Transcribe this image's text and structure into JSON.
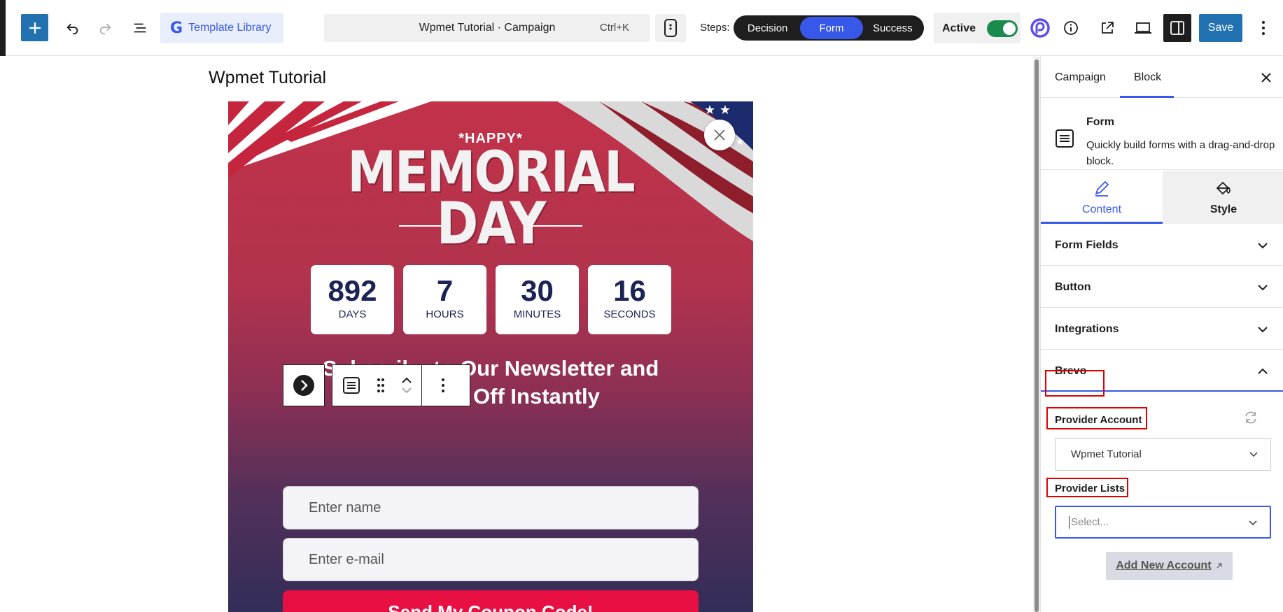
{
  "toolbar": {
    "template_library": "Template Library",
    "command_title": "Wpmet Tutorial · Campaign",
    "command_shortcut": "Ctrl+K",
    "steps_label": "Steps:",
    "steps": [
      "Decision",
      "Form",
      "Success"
    ],
    "active_step": "Form",
    "active_label": "Active",
    "active_on": true,
    "save_label": "Save",
    "accent_color": "#2271b1",
    "toggle_color": "#1a8a4d"
  },
  "canvas": {
    "page_title": "Wpmet Tutorial",
    "popup": {
      "happy": "*HAPPY*",
      "memorial": "MEMORIAL",
      "day": "DAY",
      "countdown": [
        {
          "value": "892",
          "unit": "DAYS"
        },
        {
          "value": "7",
          "unit": "HOURS"
        },
        {
          "value": "30",
          "unit": "MINUTES"
        },
        {
          "value": "16",
          "unit": "SECONDS"
        }
      ],
      "headline_line1": "Subscribe to Our Newsletter and",
      "headline_line2": "Get 15% Off Instantly",
      "name_placeholder": "Enter name",
      "email_placeholder": "Enter e-mail",
      "submit_label": "Send My Coupon Code!",
      "button_color": "#e80f42"
    }
  },
  "panel": {
    "tabs": [
      "Campaign",
      "Block"
    ],
    "active_tab": "Block",
    "block": {
      "name": "Form",
      "description": "Quickly build forms with a drag-and-drop block."
    },
    "content_tabs": [
      "Content",
      "Style"
    ],
    "active_content_tab": "Content",
    "sections": [
      "Form Fields",
      "Button",
      "Integrations",
      "Brevo"
    ],
    "open_section": "Brevo",
    "brevo": {
      "provider_account_label": "Provider Account",
      "provider_account_value": "Wpmet Tutorial",
      "provider_lists_label": "Provider Lists",
      "provider_lists_placeholder": "Select...",
      "add_account_label": "Add New Account"
    }
  }
}
